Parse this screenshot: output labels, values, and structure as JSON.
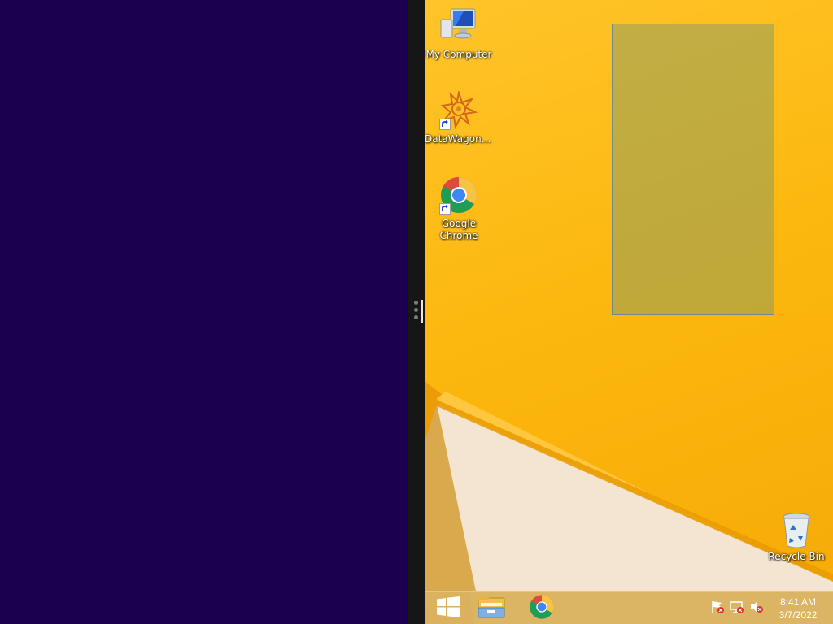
{
  "left_pane": {
    "background": "#1c0050"
  },
  "desktop": {
    "wallpaper_colors": [
      "#ffc42a",
      "#f6aa06",
      "#f2e2c8"
    ],
    "icons": [
      {
        "label": "My Computer",
        "icon": "computer-icon"
      },
      {
        "label": "DataWagon....",
        "icon": "datawagon-icon"
      },
      {
        "label": "Google Chrome",
        "icon": "chrome-icon"
      },
      {
        "label": "Recycle Bin",
        "icon": "recycle-bin-icon"
      }
    ]
  },
  "taskbar": {
    "pinned": [
      {
        "name": "start",
        "icon": "windows-logo-icon"
      },
      {
        "name": "file-explorer",
        "icon": "folder-icon"
      },
      {
        "name": "chrome",
        "icon": "chrome-icon"
      }
    ],
    "tray": [
      {
        "name": "action-center",
        "icon": "flag-icon"
      },
      {
        "name": "network",
        "icon": "network-icon"
      },
      {
        "name": "volume",
        "icon": "speaker-muted-icon"
      }
    ],
    "clock": {
      "time": "8:41 AM",
      "date": "3/7/2022"
    }
  },
  "colors": {
    "divider": "#161616",
    "selection": "#6e8894",
    "text_on_desktop": "#ffffff"
  }
}
